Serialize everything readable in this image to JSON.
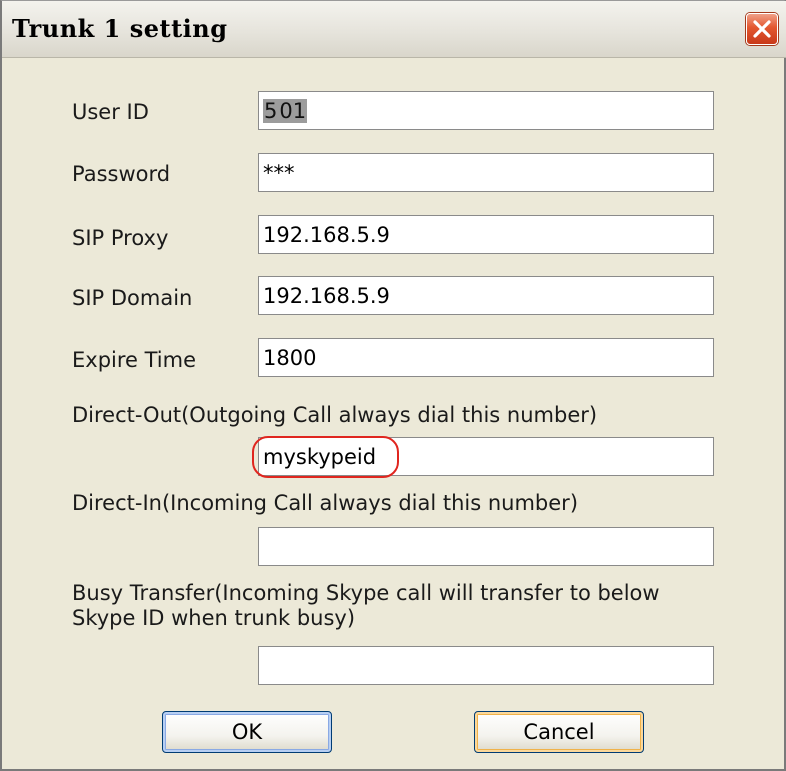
{
  "window": {
    "title": "Trunk 1 setting",
    "close_icon": "close-icon"
  },
  "form": {
    "user_id": {
      "label": "User ID",
      "value_selected": "5",
      "value_rest": "01"
    },
    "password": {
      "label": "Password",
      "value": "***"
    },
    "sip_proxy": {
      "label": "SIP Proxy",
      "value": "192.168.5.9"
    },
    "sip_domain": {
      "label": "SIP Domain",
      "value": "192.168.5.9"
    },
    "expire_time": {
      "label": "Expire Time",
      "value": "1800"
    },
    "direct_out": {
      "label": "Direct-Out(Outgoing Call always dial this number)",
      "value": "myskypeid"
    },
    "direct_in": {
      "label": "Direct-In(Incoming Call always dial this number)",
      "value": ""
    },
    "busy_transfer": {
      "label_line1": "Busy Transfer(Incoming Skype call will transfer to below",
      "label_line2": "Skype ID when trunk busy)",
      "value": ""
    }
  },
  "buttons": {
    "ok_label": "OK",
    "cancel_label": "Cancel"
  },
  "colors": {
    "dialog_bg": "#ece9d8",
    "annotation_circle": "#e0261f",
    "close_button": "#e3572f"
  }
}
